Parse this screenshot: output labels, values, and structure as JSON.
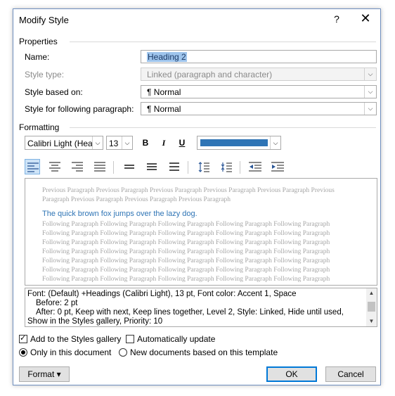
{
  "dialog": {
    "title": "Modify Style",
    "help_glyph": "?",
    "close_glyph": "✕"
  },
  "properties": {
    "section_label": "Properties",
    "name_label": "Name:",
    "name_value": "Heading 2",
    "style_type_label": "Style type:",
    "style_type_value": "Linked (paragraph and character)",
    "based_on_label": "Style based on:",
    "based_on_value": "¶  Normal",
    "following_label": "Style for following paragraph:",
    "following_value": "¶  Normal"
  },
  "formatting": {
    "section_label": "Formatting",
    "font_name": "Calibri Light (Head",
    "font_size": "13",
    "bold": "B",
    "italic": "I",
    "underline": "U",
    "font_color": "#2e74b5",
    "toolbar_icons": [
      "align-left-icon",
      "align-center-icon",
      "align-right-icon",
      "justify-icon",
      "single-spacing-icon",
      "one-half-spacing-icon",
      "double-spacing-icon",
      "increase-paragraph-spacing-icon",
      "decrease-paragraph-spacing-icon",
      "decrease-indent-icon",
      "increase-indent-icon"
    ]
  },
  "preview": {
    "previous_text": "Previous Paragraph Previous Paragraph Previous Paragraph Previous Paragraph Previous Paragraph Previous Paragraph Previous Paragraph Previous Paragraph Previous Paragraph",
    "sample_text": "The quick brown fox jumps over the lazy dog.",
    "following_text": "Following Paragraph Following Paragraph Following Paragraph Following Paragraph Following Paragraph Following Paragraph Following Paragraph Following Paragraph Following Paragraph Following Paragraph Following Paragraph Following Paragraph Following Paragraph Following Paragraph Following Paragraph Following Paragraph Following Paragraph Following Paragraph Following Paragraph Following Paragraph Following Paragraph Following Paragraph Following Paragraph Following Paragraph Following Paragraph Following Paragraph Following Paragraph Following Paragraph Following Paragraph Following Paragraph Following Paragraph Following Paragraph Following Paragraph Following Paragraph Following Paragraph Following Paragraph Following Paragraph"
  },
  "description": {
    "line1": "Font: (Default) +Headings (Calibri Light), 13 pt, Font color: Accent 1, Space",
    "line2": "Before:  2 pt",
    "line3": "After:  0 pt, Keep with next, Keep lines together, Level 2, Style: Linked, Hide until used,",
    "line4": "Show in the Styles gallery, Priority: 10"
  },
  "options": {
    "add_to_gallery": "Add to the Styles gallery",
    "auto_update": "Automatically update",
    "only_this_doc": "Only in this document",
    "new_docs": "New documents based on this template"
  },
  "buttons": {
    "format": "Format ▾",
    "ok": "OK",
    "cancel": "Cancel"
  }
}
